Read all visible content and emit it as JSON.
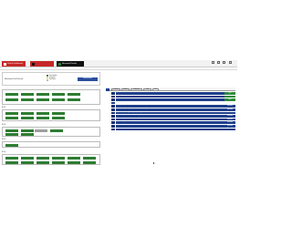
{
  "tabs": [
    {
      "label": "Vehicle Dashboard",
      "color": "#c62828"
    },
    {
      "label": "",
      "color": "#c62828"
    },
    {
      "label": "Measured Results",
      "color": "#111111"
    }
  ],
  "left_panel": {
    "title": "Measured Test Results",
    "legend": [
      "Test Complete",
      "In Progress",
      "Not Started"
    ],
    "action_button": "Refresh Results",
    "groups": [
      {
        "label": "",
        "buttons": [
          "",
          "",
          "",
          "",
          "",
          "",
          "",
          "",
          "",
          ""
        ]
      },
      {
        "label": "ECU",
        "buttons": [
          "",
          "",
          "",
          "",
          "",
          "",
          "",
          ""
        ]
      },
      {
        "label": "ECU",
        "buttons": [
          "",
          "",
          "",
          "",
          "",
          ""
        ]
      },
      {
        "label": "ECU",
        "buttons": [
          ""
        ]
      },
      {
        "label": "ECU",
        "buttons": [
          "",
          "",
          "",
          "",
          "",
          "",
          "",
          "",
          "",
          "",
          "",
          ""
        ]
      }
    ]
  },
  "right_panel": {
    "tabs": [
      "Overview",
      "Results",
      "Calibration",
      "Logs",
      "Info"
    ],
    "rows": [
      {
        "text": "Self Test",
        "status": "Pass",
        "status_type": "pass"
      },
      {
        "text": "Firmware",
        "status": "Pass",
        "status_type": "pass"
      },
      {
        "text": "Sensor Test",
        "status": "Pass",
        "status_type": "pass"
      },
      {
        "text": "",
        "status": "",
        "status_type": "blue"
      },
      {
        "text": "Display Configuration",
        "status": "Executed",
        "status_type": "blue"
      },
      {
        "text": "ECU - Calibrated Setup Software Start Test and Program Data",
        "status": "Executed",
        "status_type": "blue"
      },
      {
        "text": "ECU - Control Routing Check (SRC) Configuration",
        "status": "Executed",
        "status_type": "blue"
      },
      {
        "text": "ECU - Comprehensive Tests Initialization (SRC)",
        "status": "Executed",
        "status_type": "blue"
      },
      {
        "text": "ECU - Comprehensive Test (SRC) Configuration",
        "status": "Executed",
        "status_type": "blue"
      },
      {
        "text": "ECU - Security Authorization",
        "status": "Executed",
        "status_type": "blue"
      },
      {
        "text": "ECU - Calibrated Component Status Software",
        "status": "Executed",
        "status_type": "blue"
      },
      {
        "text": "ECU - Verification",
        "status": "Executed",
        "status_type": "blue"
      }
    ]
  }
}
